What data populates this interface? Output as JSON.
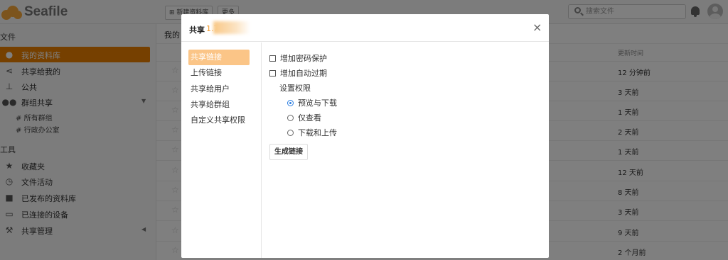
{
  "app": {
    "name": "Seafile"
  },
  "toolbar": {
    "new_library": "新建资料库",
    "more": "更多"
  },
  "search": {
    "placeholder": "搜索文件"
  },
  "sidebar": {
    "files_heading": "文件",
    "files_items": [
      {
        "label": "我的资料库",
        "icon": "user-icon"
      },
      {
        "label": "共享给我的",
        "icon": "share-icon"
      },
      {
        "label": "公共",
        "icon": "org-icon"
      },
      {
        "label": "群组共享",
        "icon": "group-icon"
      }
    ],
    "groups": [
      "所有群组",
      "行政办公室"
    ],
    "tools_heading": "工具",
    "tools_items": [
      {
        "label": "收藏夹",
        "icon": "star-icon"
      },
      {
        "label": "文件活动",
        "icon": "clock-icon"
      },
      {
        "label": "已发布的资料库",
        "icon": "book-icon"
      },
      {
        "label": "已连接的设备",
        "icon": "monitor-icon"
      },
      {
        "label": "共享管理",
        "icon": "wrench-icon"
      }
    ]
  },
  "main": {
    "title": "我的",
    "modified_header": "更新时间",
    "times": [
      "12 分钟前",
      "3 天前",
      "1 天前",
      "2 天前",
      "1 天前",
      "12 天前",
      "8 天前",
      "3 天前",
      "9 天前",
      "2 个月前"
    ]
  },
  "modal": {
    "title": "共享",
    "file_name_prefix": "1.7",
    "close": "×",
    "tabs": [
      "共享链接",
      "上传链接",
      "共享给用户",
      "共享给群组",
      "自定义共享权限"
    ],
    "password_protect": "增加密码保护",
    "auto_expire": "增加自动过期",
    "permission_label": "设置权限",
    "permissions": [
      "预览与下载",
      "仅查看",
      "下载和上传"
    ],
    "selected_permission": "预览与下载",
    "generate_button": "生成链接"
  },
  "colors": {
    "accent": "#ec8000",
    "tab_active": "#fbc587",
    "radio": "#2a7de1"
  }
}
